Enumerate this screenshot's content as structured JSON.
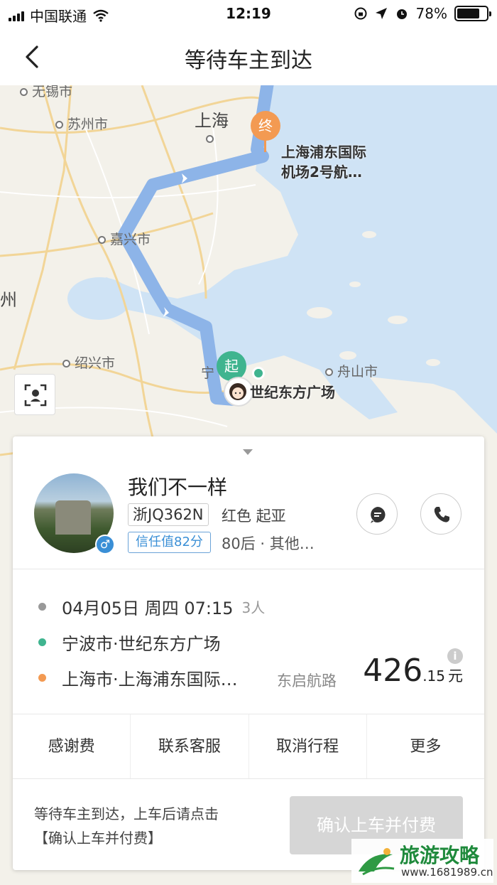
{
  "status_bar": {
    "carrier": "中国联通",
    "time": "12:19",
    "battery": "78%",
    "battery_level": 0.78
  },
  "nav": {
    "title": "等待车主到达"
  },
  "map": {
    "labels": {
      "wuxi": "无锡市",
      "suzhou": "苏州市",
      "shanghai": "上海",
      "jiaxing": "嘉兴市",
      "shaoxing": "绍兴市",
      "zhoushan": "舟山市",
      "zhou": "州",
      "ningbo_partial": "宁"
    },
    "end_pin": "终",
    "start_pin": "起",
    "destination_line1": "上海浦东国际",
    "destination_line2": "机场2号航…",
    "origin_label": "世纪东方广场"
  },
  "driver": {
    "name": "我们不一样",
    "plate": "浙JQ362N",
    "car": "红色 起亚",
    "trust": "信任值82分",
    "tags": "80后 · 其他…",
    "gender": "♂"
  },
  "trip": {
    "datetime": "04月05日 周四 07:15",
    "passengers": "3人",
    "origin": "宁波市·世纪东方广场",
    "destination": "上海市·上海浦东国际…",
    "road": "东启航路",
    "price_int": "426",
    "price_dec": ".15",
    "price_unit": "元",
    "info": "i"
  },
  "actions": {
    "thanks": "感谢费",
    "service": "联系客服",
    "cancel": "取消行程",
    "more": "更多"
  },
  "footer": {
    "hint_line1": "等待车主到达，上车后请点击",
    "hint_line2": "【确认上车并付费】",
    "confirm": "确认上车并付费"
  },
  "watermark": {
    "title": "旅游攻略",
    "url": "www.1681989.cn"
  },
  "colors": {
    "route": "#8db4e8",
    "start_green": "#3fb48f",
    "end_orange": "#f39a52",
    "trust_blue": "#3a8fd6",
    "sea": "#cfe3f5",
    "land": "#f3f1ea"
  }
}
